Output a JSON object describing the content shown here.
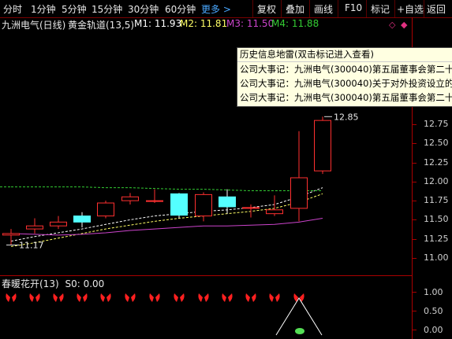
{
  "toolbar": {
    "timeframes": [
      "分时",
      "1分钟",
      "5分钟",
      "15分钟",
      "30分钟",
      "60分钟"
    ],
    "more": "更多 >",
    "buttons": [
      "复权",
      "叠加",
      "画线",
      "F10",
      "标记",
      "+自选",
      "返回"
    ]
  },
  "title": {
    "stock": "九洲电气(日线)",
    "indicator": "黄金轨道(13,5)",
    "m1": "M1: 11.93",
    "m2": "M2: 11.81",
    "m3": "M3: 11.50",
    "m4": "M4: 11.88"
  },
  "popup": {
    "header": "历史信息地雷(双击标记进入查看)",
    "items": [
      "公司大事记：九洲电气(300040)第五届董事会第二十",
      "公司大事记：九洲电气(300040)关于对外投资设立的",
      "公司大事记：九洲电气(300040)第五届董事会第二十"
    ]
  },
  "yaxis_main": [
    "12.75",
    "12.50",
    "12.25",
    "12.00",
    "11.75",
    "11.50",
    "11.25",
    "11.00"
  ],
  "annotations": {
    "high": "12.85",
    "low": "11.17"
  },
  "indicator_panel": {
    "name": "春暖花开(13)",
    "s0": "S0: 0.00",
    "yaxis": [
      "1.00",
      "0.50",
      "0.00"
    ]
  },
  "colors": {
    "up": "#ff3030",
    "down": "#54ffff",
    "line_white": "#ffffff",
    "line_yellow": "#ffff66",
    "line_green": "#33cc33",
    "line_magenta": "#cc44cc",
    "axis": "#aa0000"
  },
  "chart_data": {
    "type": "candlestick",
    "ylim": [
      10.9,
      13.0
    ],
    "candles": [
      {
        "o": 11.3,
        "h": 11.38,
        "l": 11.17,
        "c": 11.32
      },
      {
        "o": 11.38,
        "h": 11.52,
        "l": 11.32,
        "c": 11.42
      },
      {
        "o": 11.42,
        "h": 11.55,
        "l": 11.38,
        "c": 11.47
      },
      {
        "o": 11.55,
        "h": 11.6,
        "l": 11.4,
        "c": 11.47
      },
      {
        "o": 11.55,
        "h": 11.75,
        "l": 11.52,
        "c": 11.72
      },
      {
        "o": 11.75,
        "h": 11.85,
        "l": 11.7,
        "c": 11.8
      },
      {
        "o": 11.75,
        "h": 11.9,
        "l": 11.72,
        "c": 11.75
      },
      {
        "o": 11.84,
        "h": 11.85,
        "l": 11.52,
        "c": 11.56
      },
      {
        "o": 11.55,
        "h": 11.86,
        "l": 11.48,
        "c": 11.83
      },
      {
        "o": 11.8,
        "h": 11.9,
        "l": 11.58,
        "c": 11.67
      },
      {
        "o": 11.65,
        "h": 11.7,
        "l": 11.53,
        "c": 11.66
      },
      {
        "o": 11.58,
        "h": 11.82,
        "l": 11.55,
        "c": 11.63
      },
      {
        "o": 11.65,
        "h": 12.66,
        "l": 11.48,
        "c": 12.05
      },
      {
        "o": 12.14,
        "h": 12.85,
        "l": 12.1,
        "c": 12.8
      }
    ],
    "lines": [
      {
        "name": "M1",
        "color": "#ffffff",
        "values": [
          11.22,
          11.28,
          11.33,
          11.38,
          11.44,
          11.5,
          11.55,
          11.58,
          11.61,
          11.63,
          11.66,
          11.7,
          11.8,
          11.92
        ]
      },
      {
        "name": "M2",
        "color": "#ffff66",
        "values": [
          11.15,
          11.2,
          11.26,
          11.32,
          11.38,
          11.43,
          11.48,
          11.52,
          11.55,
          11.58,
          11.61,
          11.65,
          11.73,
          11.84
        ]
      },
      {
        "name": "M3",
        "color": "#cc44cc",
        "values": [
          11.32,
          11.31,
          11.3,
          11.31,
          11.33,
          11.36,
          11.38,
          11.4,
          11.42,
          11.42,
          11.43,
          11.44,
          11.47,
          11.52
        ]
      },
      {
        "name": "M4",
        "color": "#33cc33",
        "values": [
          11.93,
          11.93,
          11.93,
          11.93,
          11.92,
          11.92,
          11.91,
          11.9,
          11.9,
          11.89,
          11.88,
          11.88,
          11.88,
          11.88
        ]
      }
    ]
  }
}
